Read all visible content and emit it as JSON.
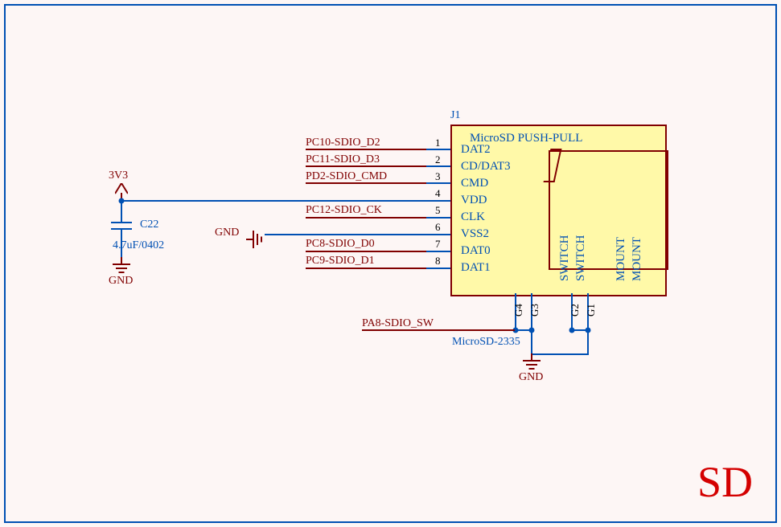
{
  "title": "SD",
  "power_rail": "3V3",
  "cap": {
    "ref": "C22",
    "value": "4.7uF/0402"
  },
  "gnd": "GND",
  "connector": {
    "ref": "J1",
    "title": "MicroSD PUSH-PULL",
    "partnum": "MicroSD-2335",
    "pins": [
      {
        "num": "1",
        "name": "DAT2",
        "net": "PC10-SDIO_D2"
      },
      {
        "num": "2",
        "name": "CD/DAT3",
        "net": "PC11-SDIO_D3"
      },
      {
        "num": "3",
        "name": "CMD",
        "net": "PD2-SDIO_CMD"
      },
      {
        "num": "4",
        "name": "VDD",
        "net": ""
      },
      {
        "num": "5",
        "name": "CLK",
        "net": "PC12-SDIO_CK"
      },
      {
        "num": "6",
        "name": "VSS2",
        "net": ""
      },
      {
        "num": "7",
        "name": "DAT0",
        "net": "PC8-SDIO_D0"
      },
      {
        "num": "8",
        "name": "DAT1",
        "net": "PC9-SDIO_D1"
      }
    ],
    "bottom": [
      {
        "num": "G4",
        "name": "SWITCH"
      },
      {
        "num": "G3",
        "name": "SWITCH"
      },
      {
        "num": "G2",
        "name": "MOUNT"
      },
      {
        "num": "G1",
        "name": "MOUNT"
      }
    ]
  },
  "switch_net": "PA8-SDIO_SW"
}
